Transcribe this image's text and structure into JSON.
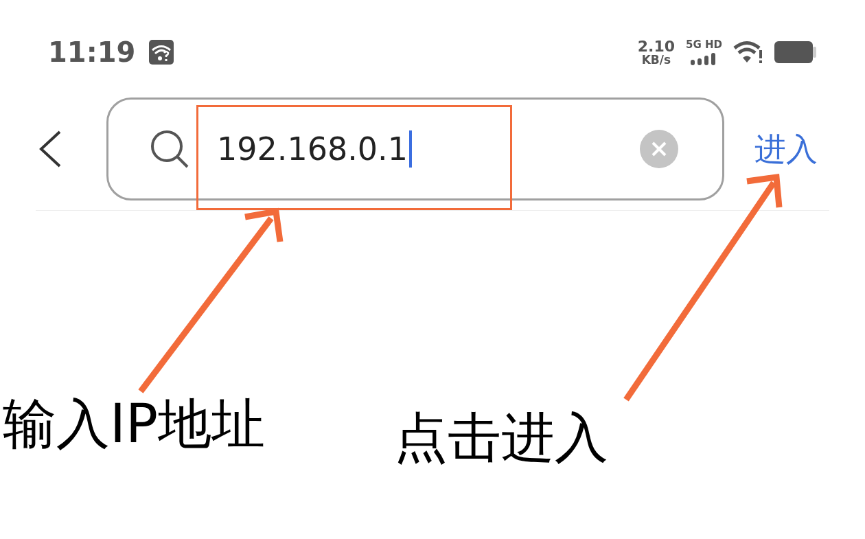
{
  "status_bar": {
    "time": "11:19",
    "speed_value": "2.10",
    "speed_unit": "KB/s",
    "network": "5G HD"
  },
  "search": {
    "value": "192.168.0.1",
    "focused": true
  },
  "enter_button": "进入",
  "annotations": [
    {
      "label": "输入IP地址"
    },
    {
      "label": "点击进入"
    }
  ]
}
